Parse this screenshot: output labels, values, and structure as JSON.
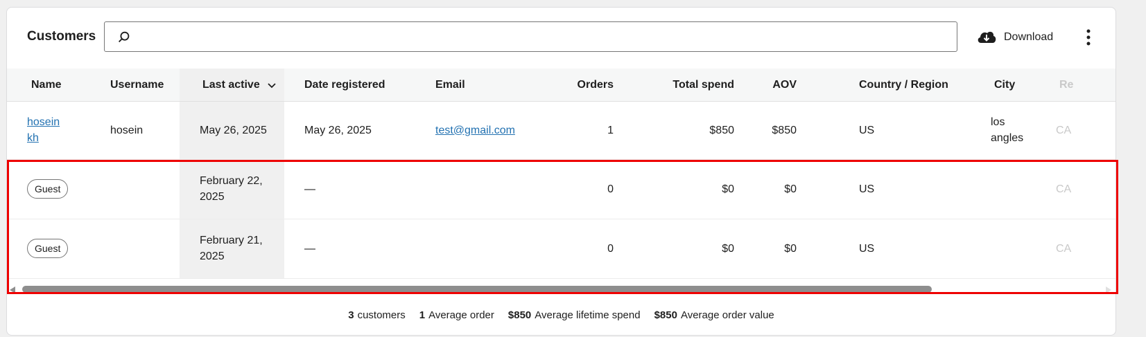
{
  "header": {
    "title": "Customers",
    "search_placeholder": "",
    "download_label": "Download"
  },
  "table": {
    "columns": [
      "Name",
      "Username",
      "Last active",
      "Date registered",
      "Email",
      "Orders",
      "Total spend",
      "AOV",
      "Country / Region",
      "City",
      "Re"
    ],
    "sorted_column": "Last active",
    "rows": [
      {
        "name_line1": "hosein",
        "name_line2": "kh",
        "username": "hosein",
        "last_active": "May 26, 2025",
        "date_registered": "May 26, 2025",
        "email": "test@gmail.com",
        "orders": "1",
        "total_spend": "$850",
        "aov": "$850",
        "country": "US",
        "city_line1": "los",
        "city_line2": "angles",
        "region": "CA"
      },
      {
        "name": "Guest",
        "username": "",
        "last_active_line1": "February 22,",
        "last_active_line2": "2025",
        "date_registered": "—",
        "email": "",
        "orders": "0",
        "total_spend": "$0",
        "aov": "$0",
        "country": "US",
        "city": "",
        "region": "CA"
      },
      {
        "name": "Guest",
        "username": "",
        "last_active_line1": "February 21,",
        "last_active_line2": "2025",
        "date_registered": "—",
        "email": "",
        "orders": "0",
        "total_spend": "$0",
        "aov": "$0",
        "country": "US",
        "city": "",
        "region": "CA"
      }
    ]
  },
  "summary": {
    "customers_count": "3",
    "customers_label": "customers",
    "avg_order_count": "1",
    "avg_order_label": "Average order",
    "lifetime_spend_value": "$850",
    "lifetime_spend_label": "Average lifetime spend",
    "order_value_value": "$850",
    "order_value_label": "Average order value"
  },
  "colors": {
    "link": "#2271b1",
    "highlight": "#ee0000",
    "sorted_bg": "#f0f0f0"
  },
  "icons": [
    "search-icon",
    "cloud-download-icon",
    "more-vertical-icon",
    "chevron-down-icon",
    "arrow-left-icon",
    "arrow-right-icon"
  ]
}
